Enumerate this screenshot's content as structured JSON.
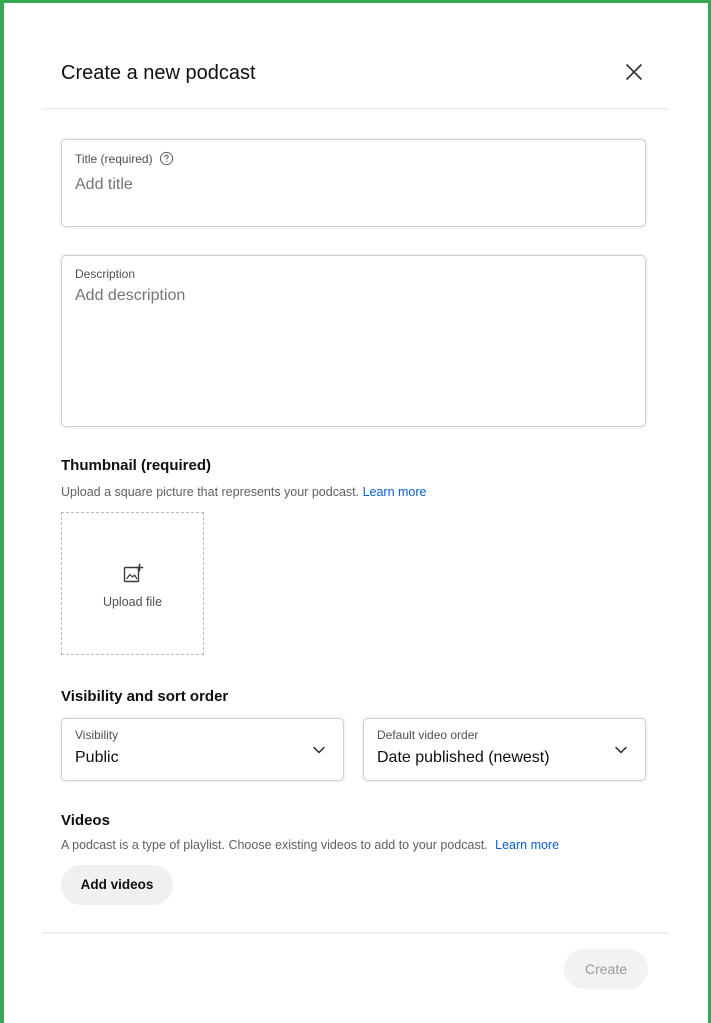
{
  "dialog": {
    "title": "Create a new podcast"
  },
  "title_field": {
    "label": "Title (required)",
    "placeholder": "Add title"
  },
  "description_field": {
    "label": "Description",
    "placeholder": "Add description"
  },
  "thumbnail": {
    "heading": "Thumbnail (required)",
    "subtitle": "Upload a square picture that represents your podcast.",
    "learn_more": "Learn more",
    "upload_label": "Upload file"
  },
  "visibility_section": {
    "heading": "Visibility and sort order",
    "visibility": {
      "label": "Visibility",
      "value": "Public"
    },
    "order": {
      "label": "Default video order",
      "value": "Date published (newest)"
    }
  },
  "videos": {
    "heading": "Videos",
    "subtitle": "A podcast is a type of playlist. Choose existing videos to add to your podcast.",
    "learn_more": "Learn more",
    "add_button": "Add videos"
  },
  "footer": {
    "create_button": "Create"
  },
  "colors": {
    "frame_border": "#34a853",
    "link": "#065fd4",
    "disabled_text": "#9a9a9a"
  }
}
